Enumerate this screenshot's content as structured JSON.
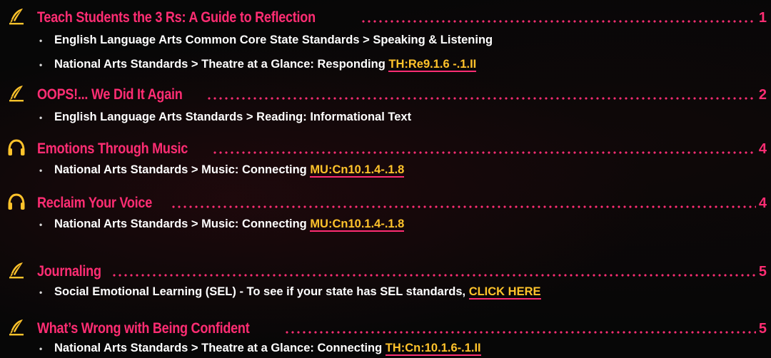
{
  "colors": {
    "background": "#070707",
    "title": "#ff2d73",
    "text": "#ffffff",
    "link": "#ffc32b",
    "link_underline": "#ff2d73",
    "icon": "#ffc32b"
  },
  "entries": [
    {
      "icon": "quill-pen-icon",
      "title": "Teach Students the 3 Rs: A Guide to Reflection",
      "page": "1",
      "standards": [
        {
          "text": "English Language Arts Common Core State Standards > Speaking & Listening",
          "link": ""
        },
        {
          "text": "National Arts Standards > Theatre at a Glance: Responding ",
          "link": "TH:Re9.1.6 -.1.II"
        }
      ]
    },
    {
      "icon": "quill-pen-icon",
      "title": "OOPS!... We Did It Again",
      "page": "2",
      "standards": [
        {
          "text": "English Language Arts Standards > Reading: Informational Text",
          "link": ""
        }
      ]
    },
    {
      "icon": "headphones-icon",
      "title": "Emotions Through Music",
      "page": "4",
      "standards": [
        {
          "text": "National Arts Standards > Music: Connecting ",
          "link": "MU:Cn10.1.4-.1.8"
        }
      ]
    },
    {
      "icon": "headphones-icon",
      "title": "Reclaim Your Voice",
      "page": "4",
      "standards": [
        {
          "text": "National Arts Standards > Music: Connecting ",
          "link": "MU:Cn10.1.4-.1.8"
        }
      ]
    },
    {
      "icon": "quill-pen-icon",
      "title": "Journaling",
      "page": "5",
      "standards": [
        {
          "text": "Social Emotional Learning (SEL) - To see if your state has SEL standards, ",
          "link": "CLICK HERE"
        }
      ]
    },
    {
      "icon": "quill-pen-icon",
      "title": "What’s Wrong with Being Confident",
      "page": "5",
      "standards": [
        {
          "text": "National Arts Standards > Theatre at a Glance: Connecting ",
          "link": "TH:Cn:10.1.6-.1.II"
        }
      ]
    }
  ]
}
